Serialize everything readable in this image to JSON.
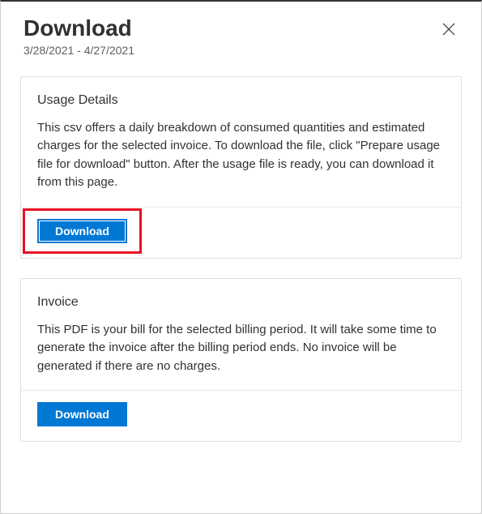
{
  "header": {
    "title": "Download",
    "date_range": "3/28/2021 - 4/27/2021"
  },
  "cards": {
    "usage": {
      "title": "Usage Details",
      "description": "This csv offers a daily breakdown of consumed quantities and estimated charges for the selected invoice. To download the file, click \"Prepare usage file for download\" button. After the usage file is ready, you can download it from this page.",
      "button_label": "Download"
    },
    "invoice": {
      "title": "Invoice",
      "description": "This PDF is your bill for the selected billing period. It will take some time to generate the invoice after the billing period ends. No invoice will be generated if there are no charges.",
      "button_label": "Download"
    }
  }
}
